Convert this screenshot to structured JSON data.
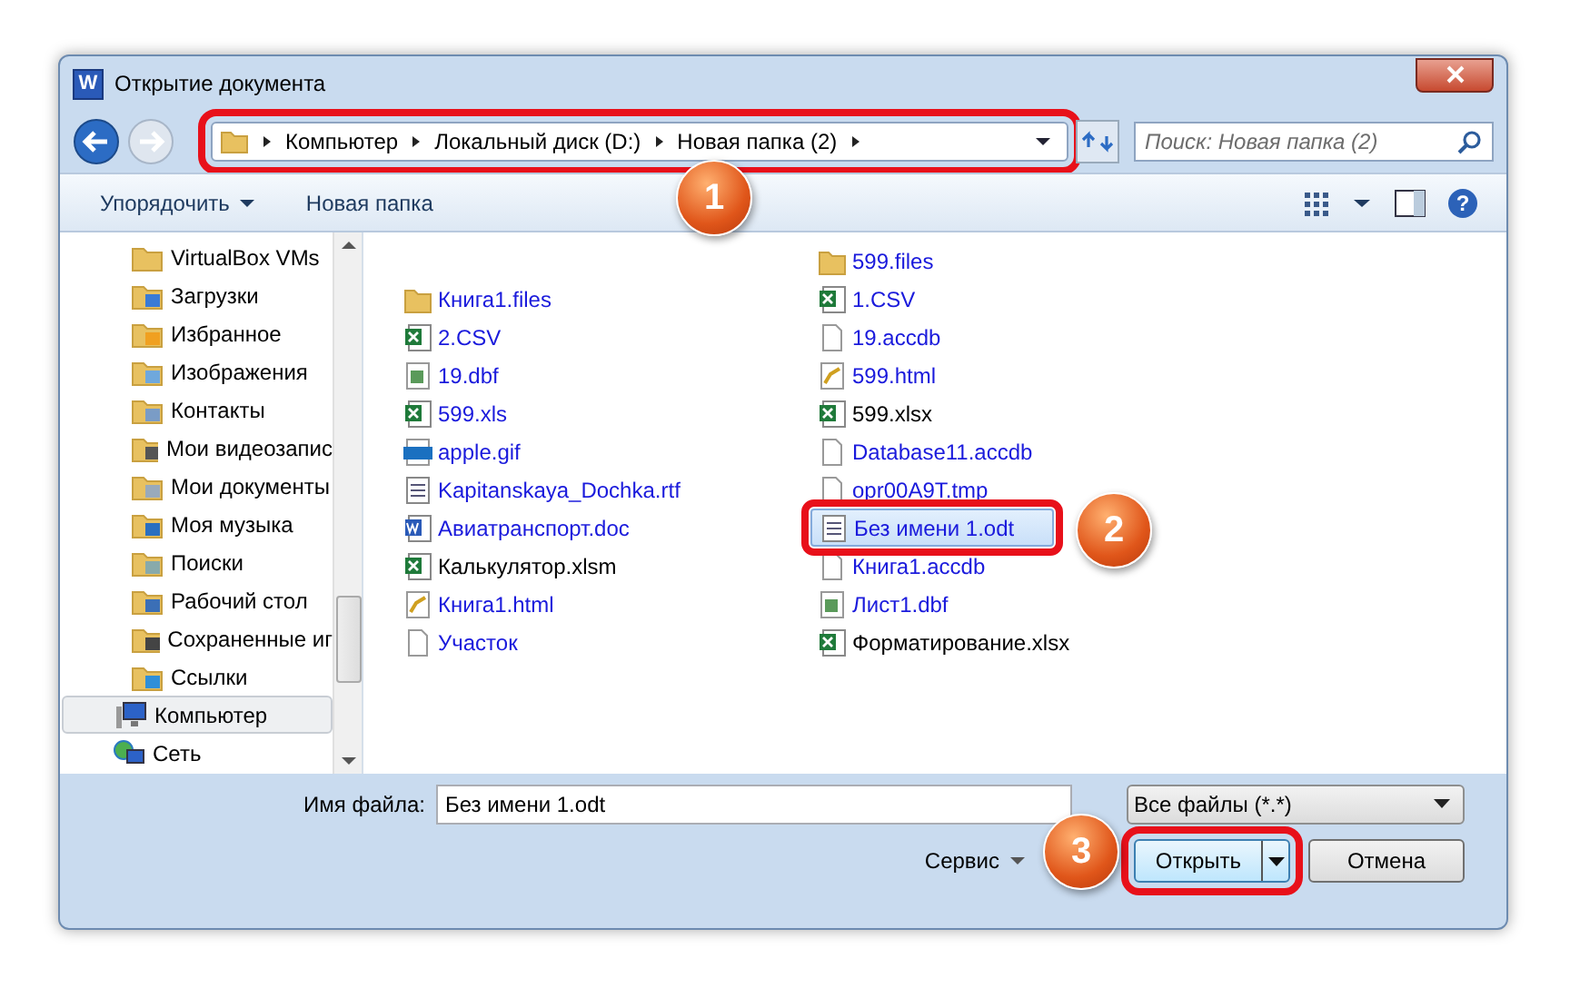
{
  "window": {
    "app_icon_letter": "W",
    "title": "Открытие документа"
  },
  "address": {
    "crumbs": [
      "Компьютер",
      "Локальный диск (D:)",
      "Новая папка (2)"
    ],
    "search_placeholder": "Поиск: Новая папка (2)"
  },
  "toolbar": {
    "buttons": [
      "Упорядочить",
      "Новая папка"
    ],
    "help": "?"
  },
  "sidebar": {
    "folders": [
      {
        "name": "VirtualBox VMs",
        "kind": "folder",
        "selected": false
      },
      {
        "name": "Загрузки",
        "kind": "download",
        "selected": false
      },
      {
        "name": "Избранное",
        "kind": "star",
        "selected": false
      },
      {
        "name": "Изображения",
        "kind": "image",
        "selected": false
      },
      {
        "name": "Контакты",
        "kind": "contact",
        "selected": false
      },
      {
        "name": "Мои видеозапис",
        "kind": "video",
        "selected": false
      },
      {
        "name": "Мои документы",
        "kind": "docs",
        "selected": false
      },
      {
        "name": "Моя музыка",
        "kind": "music",
        "selected": false
      },
      {
        "name": "Поиски",
        "kind": "search",
        "selected": false
      },
      {
        "name": "Рабочий стол",
        "kind": "desktop",
        "selected": false
      },
      {
        "name": "Сохраненные иг",
        "kind": "games",
        "selected": false
      },
      {
        "name": "Ссылки",
        "kind": "links",
        "selected": false
      }
    ],
    "places": [
      {
        "name": "Компьютер",
        "kind": "computer",
        "selected": true
      },
      {
        "name": "Сеть",
        "kind": "network",
        "selected": false
      }
    ]
  },
  "files": {
    "columns": [
      [
        {
          "name": "Книга1.files",
          "kind": "folder",
          "blue": true,
          "selected": false
        },
        {
          "name": "2.CSV",
          "kind": "sheet",
          "blue": true,
          "selected": false
        },
        {
          "name": "19.dbf",
          "kind": "dbf",
          "blue": true,
          "selected": false
        },
        {
          "name": "599.xls",
          "kind": "sheet",
          "blue": true,
          "selected": false
        },
        {
          "name": "apple.gif",
          "kind": "gif",
          "blue": true,
          "selected": false
        },
        {
          "name": "Kapitanskaya_Dochka.rtf",
          "kind": "text",
          "blue": true,
          "selected": false
        },
        {
          "name": "Авиатранспорт.doc",
          "kind": "word",
          "blue": true,
          "selected": false
        },
        {
          "name": "Калькулятор.xlsm",
          "kind": "sheet",
          "blue": false,
          "selected": false
        },
        {
          "name": "Книга1.html",
          "kind": "html",
          "blue": true,
          "selected": false
        },
        {
          "name": "Участок",
          "kind": "blank",
          "blue": true,
          "selected": false
        }
      ],
      [
        {
          "name": "599.files",
          "kind": "folder",
          "blue": true,
          "selected": false
        },
        {
          "name": "1.CSV",
          "kind": "sheet",
          "blue": true,
          "selected": false
        },
        {
          "name": "19.accdb",
          "kind": "blank",
          "blue": true,
          "selected": false
        },
        {
          "name": "599.html",
          "kind": "html",
          "blue": true,
          "selected": false
        },
        {
          "name": "599.xlsx",
          "kind": "sheet",
          "blue": false,
          "selected": false
        },
        {
          "name": "Database11.accdb",
          "kind": "blank",
          "blue": true,
          "selected": false
        },
        {
          "name": "opr00A9T.tmp",
          "kind": "blank",
          "blue": true,
          "selected": false
        },
        {
          "name": "Без имени 1.odt",
          "kind": "text",
          "blue": true,
          "selected": true
        },
        {
          "name": "Книга1.accdb",
          "kind": "blank",
          "blue": true,
          "selected": false
        },
        {
          "name": "Лист1.dbf",
          "kind": "dbf",
          "blue": true,
          "selected": false
        },
        {
          "name": "Форматирование.xlsx",
          "kind": "sheet",
          "blue": false,
          "selected": false
        }
      ]
    ]
  },
  "bottom": {
    "filename_label": "Имя файла:",
    "filename": "Без имени 1.odt",
    "filter": "Все файлы (*.*)",
    "tools": "Сервис",
    "open": "Открыть",
    "cancel": "Отмена"
  },
  "callouts": [
    "1",
    "2",
    "3"
  ]
}
